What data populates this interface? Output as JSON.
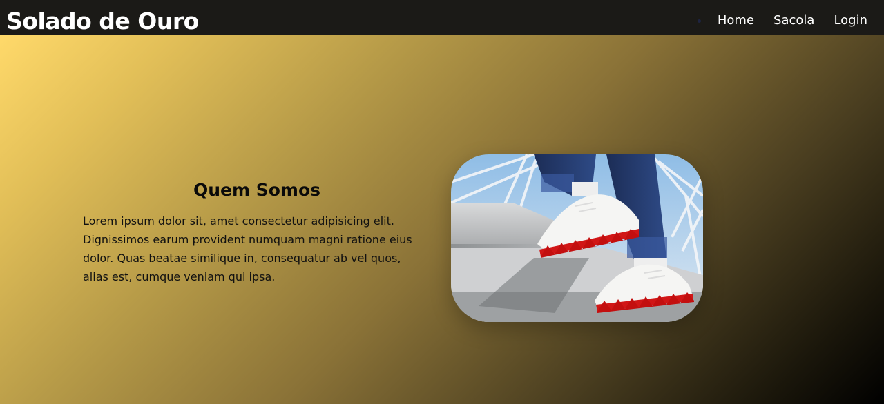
{
  "header": {
    "brand": "Solado de Ouro",
    "nav": [
      {
        "label": "Home"
      },
      {
        "label": "Sacola"
      },
      {
        "label": "Login"
      }
    ]
  },
  "about": {
    "title": "Quem Somos",
    "text": "Lorem ipsum dolor sit, amet consectetur adipisicing elit. Dignissimos earum provident numquam magni ratione eius dolor. Quas beatae similique in, consequatur ab vel quos, alias est, cumque veniam qui ipsa."
  },
  "image": {
    "subject": "sneakers-on-stairs-photo"
  },
  "colors": {
    "topbar": "#1b1a17",
    "gradient_start": "#ffd96a",
    "gradient_end": "#000000",
    "text_dark": "#0a0a0a",
    "nav_text": "#ffffff"
  }
}
